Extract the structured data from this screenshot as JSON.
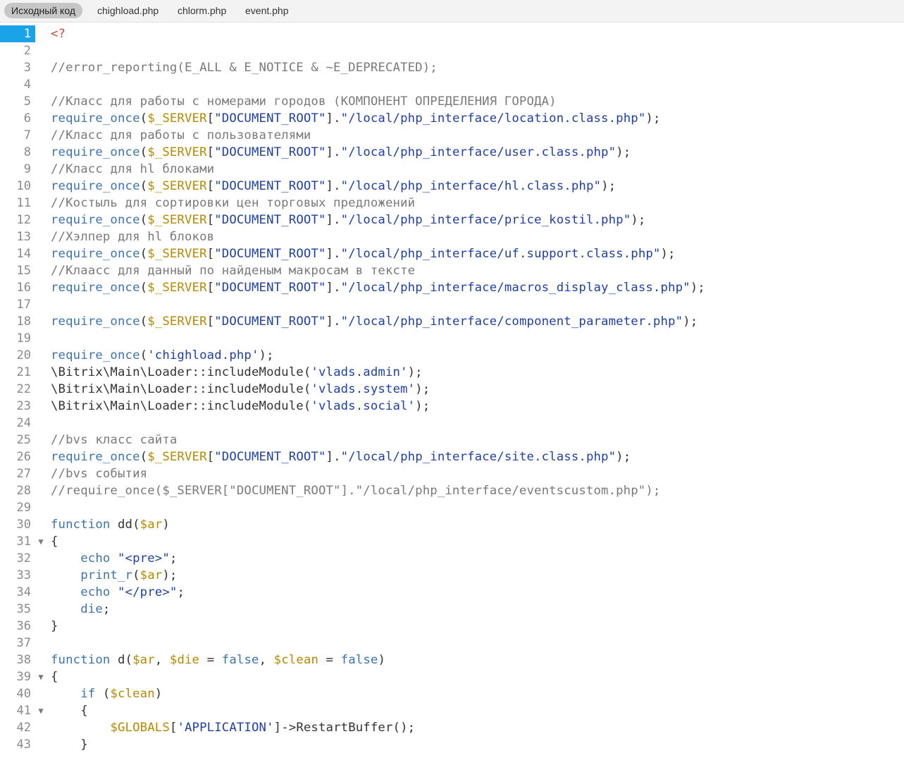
{
  "tabs": [
    {
      "label": "Исходный код",
      "active": true
    },
    {
      "label": "chighload.php",
      "active": false
    },
    {
      "label": "chlorm.php",
      "active": false
    },
    {
      "label": "event.php",
      "active": false
    }
  ],
  "colors": {
    "plain": "#333333",
    "comment": "#7a7a7a",
    "keyword": "#3d74ad",
    "string": "#1f3fa8",
    "variable": "#b58a00",
    "php_tag": "#d4472f",
    "current_line": "#1aa3e8"
  },
  "current_line": 1,
  "fold_lines": [
    31,
    39,
    41
  ],
  "lines": [
    [
      [
        "php_tag",
        "<?"
      ]
    ],
    [],
    [
      [
        "comment",
        "//error_reporting(E_ALL & E_NOTICE & ~E_DEPRECATED);"
      ]
    ],
    [],
    [
      [
        "comment",
        "//Класс для работы с номерами городов (КОМПОНЕНТ ОПРЕДЕЛЕНИЯ ГОРОДА)"
      ]
    ],
    [
      [
        "keyword",
        "require_once"
      ],
      [
        "plain",
        "("
      ],
      [
        "variable",
        "$_SERVER"
      ],
      [
        "plain",
        "["
      ],
      [
        "string",
        "\"DOCUMENT_ROOT\""
      ],
      [
        "plain",
        "]."
      ],
      [
        "string",
        "\"/local/php_interface/location.class.php\""
      ],
      [
        "plain",
        ");"
      ]
    ],
    [
      [
        "comment",
        "//Класс для работы с пользователями"
      ]
    ],
    [
      [
        "keyword",
        "require_once"
      ],
      [
        "plain",
        "("
      ],
      [
        "variable",
        "$_SERVER"
      ],
      [
        "plain",
        "["
      ],
      [
        "string",
        "\"DOCUMENT_ROOT\""
      ],
      [
        "plain",
        "]."
      ],
      [
        "string",
        "\"/local/php_interface/user.class.php\""
      ],
      [
        "plain",
        ");"
      ]
    ],
    [
      [
        "comment",
        "//Класс для hl блоками"
      ]
    ],
    [
      [
        "keyword",
        "require_once"
      ],
      [
        "plain",
        "("
      ],
      [
        "variable",
        "$_SERVER"
      ],
      [
        "plain",
        "["
      ],
      [
        "string",
        "\"DOCUMENT_ROOT\""
      ],
      [
        "plain",
        "]."
      ],
      [
        "string",
        "\"/local/php_interface/hl.class.php\""
      ],
      [
        "plain",
        ");"
      ]
    ],
    [
      [
        "comment",
        "//Костыль для сортировки цен торговых предложений"
      ]
    ],
    [
      [
        "keyword",
        "require_once"
      ],
      [
        "plain",
        "("
      ],
      [
        "variable",
        "$_SERVER"
      ],
      [
        "plain",
        "["
      ],
      [
        "string",
        "\"DOCUMENT_ROOT\""
      ],
      [
        "plain",
        "]."
      ],
      [
        "string",
        "\"/local/php_interface/price_kostil.php\""
      ],
      [
        "plain",
        ");"
      ]
    ],
    [
      [
        "comment",
        "//Хэлпер для hl блоков"
      ]
    ],
    [
      [
        "keyword",
        "require_once"
      ],
      [
        "plain",
        "("
      ],
      [
        "variable",
        "$_SERVER"
      ],
      [
        "plain",
        "["
      ],
      [
        "string",
        "\"DOCUMENT_ROOT\""
      ],
      [
        "plain",
        "]."
      ],
      [
        "string",
        "\"/local/php_interface/uf.support.class.php\""
      ],
      [
        "plain",
        ");"
      ]
    ],
    [
      [
        "comment",
        "//Клаасс для данный по найденым макросам в тексте"
      ]
    ],
    [
      [
        "keyword",
        "require_once"
      ],
      [
        "plain",
        "("
      ],
      [
        "variable",
        "$_SERVER"
      ],
      [
        "plain",
        "["
      ],
      [
        "string",
        "\"DOCUMENT_ROOT\""
      ],
      [
        "plain",
        "]."
      ],
      [
        "string",
        "\"/local/php_interface/macros_display_class.php\""
      ],
      [
        "plain",
        ");"
      ]
    ],
    [],
    [
      [
        "keyword",
        "require_once"
      ],
      [
        "plain",
        "("
      ],
      [
        "variable",
        "$_SERVER"
      ],
      [
        "plain",
        "["
      ],
      [
        "string",
        "\"DOCUMENT_ROOT\""
      ],
      [
        "plain",
        "]."
      ],
      [
        "string",
        "\"/local/php_interface/component_parameter.php\""
      ],
      [
        "plain",
        ");"
      ]
    ],
    [],
    [
      [
        "keyword",
        "require_once"
      ],
      [
        "plain",
        "("
      ],
      [
        "string",
        "'chighload.php'"
      ],
      [
        "plain",
        ");"
      ]
    ],
    [
      [
        "plain",
        "\\Bitrix\\Main\\Loader::includeModule("
      ],
      [
        "string",
        "'vlads.admin'"
      ],
      [
        "plain",
        ");"
      ]
    ],
    [
      [
        "plain",
        "\\Bitrix\\Main\\Loader::includeModule("
      ],
      [
        "string",
        "'vlads.system'"
      ],
      [
        "plain",
        ");"
      ]
    ],
    [
      [
        "plain",
        "\\Bitrix\\Main\\Loader::includeModule("
      ],
      [
        "string",
        "'vlads.social'"
      ],
      [
        "plain",
        ");"
      ]
    ],
    [],
    [
      [
        "comment",
        "//bvs класс сайта"
      ]
    ],
    [
      [
        "keyword",
        "require_once"
      ],
      [
        "plain",
        "("
      ],
      [
        "variable",
        "$_SERVER"
      ],
      [
        "plain",
        "["
      ],
      [
        "string",
        "\"DOCUMENT_ROOT\""
      ],
      [
        "plain",
        "]."
      ],
      [
        "string",
        "\"/local/php_interface/site.class.php\""
      ],
      [
        "plain",
        ");"
      ]
    ],
    [
      [
        "comment",
        "//bvs события"
      ]
    ],
    [
      [
        "comment",
        "//require_once($_SERVER[\"DOCUMENT_ROOT\"].\"/local/php_interface/eventscustom.php\");"
      ]
    ],
    [],
    [
      [
        "keyword",
        "function"
      ],
      [
        "plain",
        " dd("
      ],
      [
        "variable",
        "$ar"
      ],
      [
        "plain",
        ")"
      ]
    ],
    [
      [
        "plain",
        "{"
      ]
    ],
    [
      [
        "plain",
        "    "
      ],
      [
        "keyword",
        "echo"
      ],
      [
        "plain",
        " "
      ],
      [
        "string",
        "\"<pre>\""
      ],
      [
        "plain",
        ";"
      ]
    ],
    [
      [
        "plain",
        "    "
      ],
      [
        "keyword",
        "print_r"
      ],
      [
        "plain",
        "("
      ],
      [
        "variable",
        "$ar"
      ],
      [
        "plain",
        ");"
      ]
    ],
    [
      [
        "plain",
        "    "
      ],
      [
        "keyword",
        "echo"
      ],
      [
        "plain",
        " "
      ],
      [
        "string",
        "\"</pre>\""
      ],
      [
        "plain",
        ";"
      ]
    ],
    [
      [
        "plain",
        "    "
      ],
      [
        "keyword",
        "die"
      ],
      [
        "plain",
        ";"
      ]
    ],
    [
      [
        "plain",
        "}"
      ]
    ],
    [],
    [
      [
        "keyword",
        "function"
      ],
      [
        "plain",
        " d("
      ],
      [
        "variable",
        "$ar"
      ],
      [
        "plain",
        ", "
      ],
      [
        "variable",
        "$die"
      ],
      [
        "plain",
        " = "
      ],
      [
        "keyword",
        "false"
      ],
      [
        "plain",
        ", "
      ],
      [
        "variable",
        "$clean"
      ],
      [
        "plain",
        " = "
      ],
      [
        "keyword",
        "false"
      ],
      [
        "plain",
        ")"
      ]
    ],
    [
      [
        "plain",
        "{"
      ]
    ],
    [
      [
        "plain",
        "    "
      ],
      [
        "keyword",
        "if"
      ],
      [
        "plain",
        " ("
      ],
      [
        "variable",
        "$clean"
      ],
      [
        "plain",
        ")"
      ]
    ],
    [
      [
        "plain",
        "    {"
      ]
    ],
    [
      [
        "plain",
        "        "
      ],
      [
        "variable",
        "$GLOBALS"
      ],
      [
        "plain",
        "["
      ],
      [
        "string",
        "'APPLICATION'"
      ],
      [
        "plain",
        "]->RestartBuffer();"
      ]
    ],
    [
      [
        "plain",
        "    }"
      ]
    ]
  ]
}
